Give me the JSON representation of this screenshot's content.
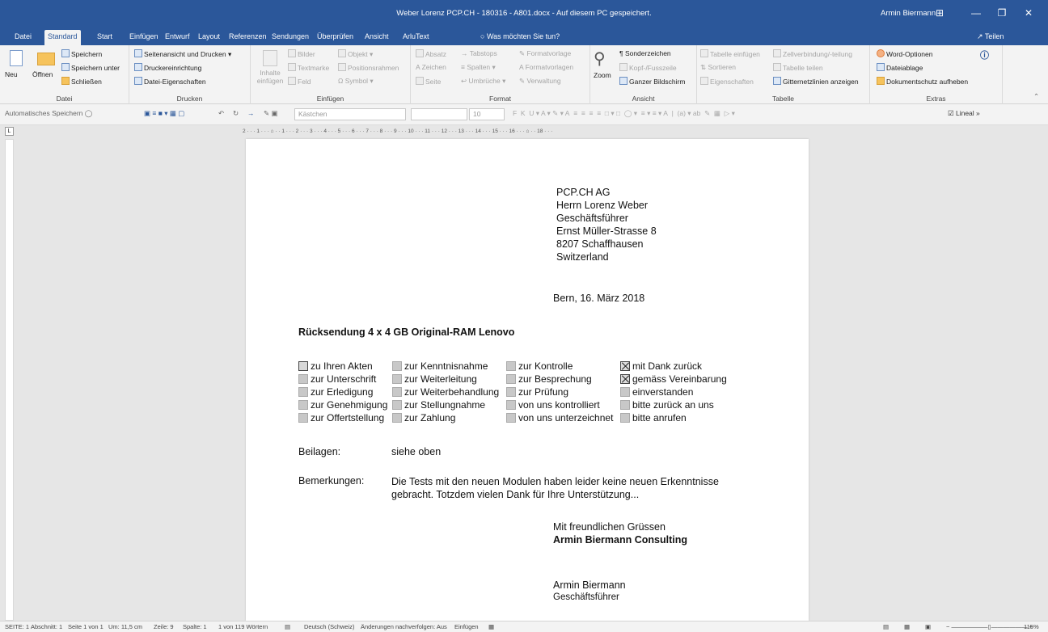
{
  "window": {
    "title": "Weber Lorenz PCP.CH - 180316 - A801.docx - Auf diesem PC gespeichert.",
    "user": "Armin Biermann",
    "controls": [
      "⊞",
      "—",
      "❐",
      "✕"
    ]
  },
  "tabs": [
    "Datei",
    "Standard",
    "Start",
    "Einfügen",
    "Entwurf",
    "Layout",
    "Referenzen",
    "Sendungen",
    "Überprüfen",
    "Ansicht",
    "ArluText"
  ],
  "tell_me": "Was möchten Sie tun?",
  "share": "Teilen",
  "ribbon": {
    "datei": {
      "label": "Datei",
      "neu": "Neu",
      "oeffnen": "Öffnen",
      "speichern": "Speichern",
      "speichern_unter": "Speichern unter",
      "schliessen": "Schließen"
    },
    "drucken": {
      "label": "Drucken",
      "items": [
        "Seitenansicht und Drucken",
        "Druckereinrichtung",
        "Datei-Eigenschaften"
      ]
    },
    "einfuegen": {
      "label": "Einfügen",
      "inhalte": "Inhalte einfügen",
      "col1": [
        "Bilder",
        "Textmarke",
        "Feld"
      ],
      "col2": [
        "Objekt",
        "Positionsrahmen",
        "Symbol"
      ]
    },
    "format": {
      "label": "Format",
      "col1": [
        "Absatz",
        "Zeichen",
        "Seite"
      ],
      "col2": [
        "Tabstops",
        "Spalten",
        "Umbrüche"
      ],
      "col3": [
        "Formatvorlage",
        "Formatvorlagen",
        "Verwaltung"
      ]
    },
    "ansicht": {
      "label": "Ansicht",
      "zoom": "Zoom",
      "items": [
        "Sonderzeichen",
        "Kopf-/Fusszeile",
        "Ganzer Bildschirm"
      ]
    },
    "tabelle": {
      "label": "Tabelle",
      "col1": [
        "Tabelle einfügen",
        "Sortieren",
        "Eigenschaften"
      ],
      "col2": [
        "Zellverbindung/-teilung",
        "Tabelle teilen",
        "Gitternetzlinien anzeigen"
      ]
    },
    "extras": {
      "label": "Extras",
      "items": [
        "Word-Optionen",
        "Dateiablage",
        "Dokumentschutz aufheben"
      ]
    }
  },
  "qat": {
    "autosave": "Automatisches Speichern",
    "style": "Kästchen",
    "font": "",
    "size": "10",
    "lineal": "Lineal"
  },
  "ruler_text": "2 · · · 1 · · · ⌂ · · 1 · · · 2 · · · 3 · · · 4 · · · 5 · · · 6 · · · 7 · · · 8 · · · 9 · · · 10 · · · 11 · · · 12 · · · 13 · · · 14 · · · 15 · · · 16 · · · ⌂ · · 18 · · ·",
  "document": {
    "address": [
      "PCP.CH AG",
      "Herrn Lorenz Weber",
      "Geschäftsführer",
      "Ernst Müller-Strasse 8",
      "8207 Schaffhausen",
      "Switzerland"
    ],
    "date": "Bern, 16. März 2018",
    "subject": "Rücksendung 4 x 4 GB Original-RAM Lenovo",
    "checkbox_columns": [
      [
        {
          "label": "zu Ihren Akten",
          "checked": false
        },
        {
          "label": "zur Unterschrift",
          "checked": false
        },
        {
          "label": "zur Erledigung",
          "checked": false
        },
        {
          "label": "zur Genehmigung",
          "checked": false
        },
        {
          "label": "zur Offertstellung",
          "checked": false
        }
      ],
      [
        {
          "label": "zur Kenntnisnahme",
          "checked": false
        },
        {
          "label": "zur Weiterleitung",
          "checked": false
        },
        {
          "label": "zur Weiterbehandlung",
          "checked": false
        },
        {
          "label": "zur Stellungnahme",
          "checked": false
        },
        {
          "label": "zur Zahlung",
          "checked": false
        }
      ],
      [
        {
          "label": "zur Kontrolle",
          "checked": false
        },
        {
          "label": "zur Besprechung",
          "checked": false
        },
        {
          "label": "zur Prüfung",
          "checked": false
        },
        {
          "label": "von uns kontrolliert",
          "checked": false
        },
        {
          "label": "von uns unterzeichnet",
          "checked": false
        }
      ],
      [
        {
          "label": "mit Dank zurück",
          "checked": true
        },
        {
          "label": "gemäss Vereinbarung",
          "checked": true
        },
        {
          "label": "einverstanden",
          "checked": false
        },
        {
          "label": "bitte zurück an uns",
          "checked": false
        },
        {
          "label": "bitte anrufen",
          "checked": false
        }
      ]
    ],
    "beilagen_label": "Beilagen:",
    "beilagen_value": "siehe oben",
    "bemerkungen_label": "Bemerkungen:",
    "bemerkungen_value": "Die Tests mit den neuen Modulen haben leider keine neuen Erkenntnisse gebracht. Totzdem vielen Dank für Ihre Unterstützung...",
    "greeting": "Mit freundlichen Grüssen",
    "company": "Armin Biermann Consulting",
    "signer": "Armin Biermann",
    "signer_title": "Geschäftsführer"
  },
  "statusbar": {
    "items": [
      "SEITE: 1",
      "Abschnitt: 1",
      "Seite 1 von 1",
      "Um: 11,5 cm",
      "Zeile: 9",
      "Spalte: 1",
      "1 von 119 Wörtern",
      "Deutsch (Schweiz)",
      "Änderungen nachverfolgen: Aus",
      "Einfügen"
    ],
    "zoom": "115%"
  },
  "colors": {
    "accent": "#2b579a",
    "ribbon": "#f3f3f3",
    "canvas": "#e6e6e6"
  }
}
